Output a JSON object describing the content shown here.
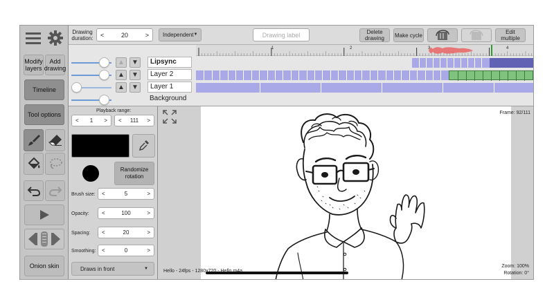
{
  "top_bar": {
    "drawing_duration_label": "Drawing duration:",
    "duration_value": "20",
    "mode_select": "Independent",
    "drawing_label_placeholder": "Drawing label",
    "delete_drawing": "Delete drawing",
    "make_cycle": "Make cycle",
    "edit_multiple": "Edit multiple"
  },
  "left_toolbar": {
    "modify_layers": "Modify layers",
    "add_drawing": "Add drawing",
    "timeline": "Timeline",
    "tool_options": "Tool options",
    "onion_skin": "Onion skin"
  },
  "timeline": {
    "ruler_marks": [
      "1",
      "2",
      "3",
      "4"
    ],
    "layers": [
      {
        "name": "Lipsync",
        "bold": true
      },
      {
        "name": "Layer 2",
        "bold": false
      },
      {
        "name": "Layer 1",
        "bold": false
      },
      {
        "name": "Background",
        "bold": false
      }
    ],
    "colors": {
      "track": "#a9a9e8",
      "track_dark": "#6262b4",
      "selected_green": "#7fc37f",
      "audio": "#e86a6a",
      "playhead": "#2f9a2f"
    }
  },
  "tool_options": {
    "playback_range_label": "Playback range:",
    "range_start": "1",
    "range_end": "111",
    "brush_color": "#000000",
    "randomize_rotation": "Randomize rotation",
    "brush_size_label": "Brush size:",
    "brush_size": "5",
    "opacity_label": "Opacity:",
    "opacity": "100",
    "spacing_label": "Spacing:",
    "spacing": "20",
    "smoothing_label": "Smoothing:",
    "smoothing": "0",
    "draw_mode": "Draws in front"
  },
  "canvas": {
    "frame_info": "Frame: 92/111",
    "project_info": "Hello - 24fps - 1280x720 - Hello m4a",
    "zoom": "Zoom: 100%",
    "rotation": "Rotation: 0°"
  }
}
